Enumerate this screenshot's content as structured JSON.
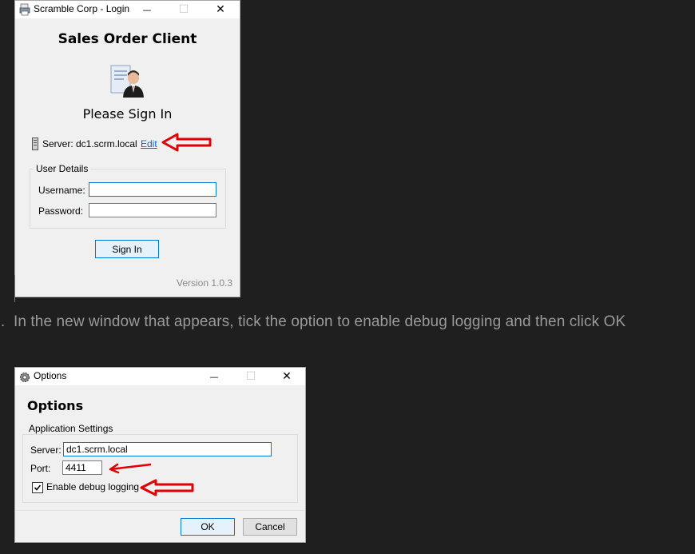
{
  "login_window": {
    "title": "Scramble Corp - Login",
    "heading": "Sales Order Client",
    "subheading": "Please Sign In",
    "server_label": "Server:",
    "server_value": "dc1.scrm.local",
    "edit_link": "Edit",
    "group_title": "User Details",
    "username_label": "Username:",
    "username_value": "",
    "password_label": "Password:",
    "password_value": "",
    "signin_button": "Sign In",
    "version": "Version 1.0.3",
    "minimize_glyph": "—",
    "maximize_glyph": "☐",
    "close_glyph": "✕"
  },
  "instruction": {
    "number": ".",
    "text": "In the new window that appears, tick the option to enable debug logging and then click OK"
  },
  "options_window": {
    "title": "Options",
    "heading": "Options",
    "group_title": "Application Settings",
    "server_label": "Server:",
    "server_value": "dc1.scrm.local",
    "port_label": "Port:",
    "port_value": "4411",
    "debug_checkbox_label": "Enable debug logging",
    "debug_checked": true,
    "ok_button": "OK",
    "cancel_button": "Cancel",
    "minimize_glyph": "—",
    "maximize_glyph": "☐",
    "close_glyph": "✕"
  },
  "colors": {
    "page_background": "#1f1f1f",
    "window_background": "#f0f0f0",
    "annotation_red": "#e00000",
    "link_blue": "#0066cc",
    "focus_blue": "#0078d7"
  }
}
